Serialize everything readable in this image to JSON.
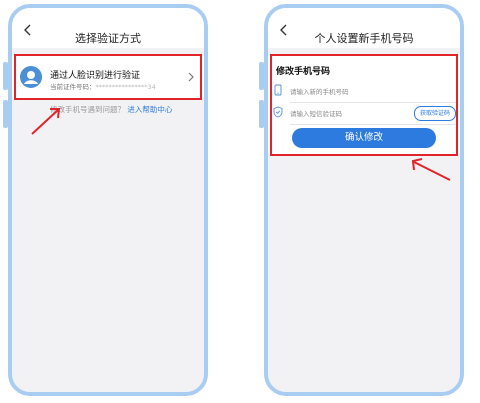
{
  "left_screen": {
    "title": "选择验证方式",
    "option": {
      "title": "通过人脸识别进行验证",
      "subtitle_label": "当前证件号码：",
      "subtitle_value": "****************34"
    },
    "help_text": "修改手机号遇到问题？",
    "help_link": "进入帮助中心"
  },
  "right_screen": {
    "title": "个人设置新手机号码",
    "section_title": "修改手机号码",
    "phone_placeholder": "请输入新的手机号码",
    "code_placeholder": "请输入短信验证码",
    "get_code_label": "获取验证码",
    "confirm_label": "确认修改"
  },
  "colors": {
    "frame": "#a9cdf0",
    "highlight": "#e2232a",
    "accent": "#2e7be0"
  }
}
